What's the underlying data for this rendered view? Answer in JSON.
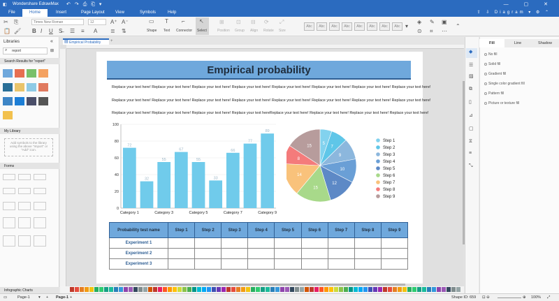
{
  "app": {
    "title": "Wondershare EdrawMax",
    "window_controls": "— ▢ ✕"
  },
  "menu": {
    "items": [
      "File",
      "Home",
      "Insert",
      "Page Layout",
      "View",
      "Symbols",
      "Help"
    ],
    "active": "Home",
    "right_label": "Diagram"
  },
  "ribbon": {
    "font_name": "Times New Roman",
    "font_size": "12",
    "tools": [
      "Shape",
      "Text",
      "Connector",
      "Select"
    ],
    "disabled_tools": [
      "Position",
      "Group",
      "Align",
      "Rotate",
      "Size"
    ],
    "style_labels": [
      "Abc",
      "Abc",
      "Abc",
      "Abc",
      "Abc",
      "Abc",
      "Abc",
      "Abc",
      "Abc",
      "Abc"
    ]
  },
  "library": {
    "title": "Libraries",
    "search_value": "report",
    "sections": {
      "search_results": "Search Results for \"report\"",
      "my_library": "My Library",
      "forms": "Forms",
      "infographic": "Infographic Charts"
    },
    "my_library_hint": "Add symbols to the library using the above \"Import\" or \"Add\" icon."
  },
  "tabs": {
    "doc_tab": "Empirical Probability"
  },
  "document": {
    "title": "Empirical probability",
    "paragraphs": [
      "Replace your text here! Replace your text here! Replace your text here! Replace your text here! Replace your text here! Replace your text here! Replace your text here! Replace your text here!",
      "Replace your text here! Replace your text here! Replace your text here! Replace your text here! Replace your text here! Replace your text here! Replace your text here! Replace your text here!",
      "Replace your text here! Replace your text here! Replace your text here! Replace your text hereReplace your text here! Replace your text here! Replace your text here! Replace your text here!"
    ],
    "table": {
      "headers": [
        "Probability test name",
        "Step 1",
        "Step 2",
        "Step 3",
        "Step 4",
        "Step 5",
        "Step 6",
        "Step 7",
        "Step 8",
        "Step 9"
      ],
      "rows": [
        "Experiment 1",
        "Experiment 2",
        "Experiment 3"
      ]
    }
  },
  "chart_data": [
    {
      "type": "bar",
      "categories": [
        "Category 1",
        "",
        "Category 3",
        "",
        "Category 5",
        "",
        "Category 7",
        "",
        "Category 9"
      ],
      "values": [
        72,
        32,
        55,
        67,
        55,
        33,
        66,
        77,
        89
      ],
      "ylim": [
        0,
        100
      ],
      "yticks": [
        0,
        20,
        40,
        60,
        80,
        100
      ],
      "color": "#70cbeb",
      "grid": true
    },
    {
      "type": "pie",
      "labels": [
        "Step 1",
        "Step 2",
        "Step 3",
        "Step 4",
        "Step 5",
        "Step 6",
        "Step 7",
        "Step 8",
        "Step 9"
      ],
      "values": [
        5,
        7,
        9,
        10,
        12,
        15,
        14,
        8,
        15
      ],
      "colors": [
        "#82d2ee",
        "#5fc6e8",
        "#8cb7dd",
        "#6a9fd6",
        "#5d89c6",
        "#a8d98a",
        "#f9c27b",
        "#f47b7b",
        "#b79c9c"
      ],
      "legend": "right"
    }
  ],
  "right_panel": {
    "tabs": [
      "Fill",
      "Line",
      "Shadow"
    ],
    "active_tab": "Fill",
    "options": [
      "No fill",
      "Solid fill",
      "Gradient fill",
      "Single color gradient fill",
      "Pattern fill",
      "Picture or texture fill"
    ]
  },
  "status": {
    "page_label": "Page-1",
    "page_tab": "Page-1",
    "shape_id": "Shape ID: 659",
    "zoom": "100%"
  }
}
